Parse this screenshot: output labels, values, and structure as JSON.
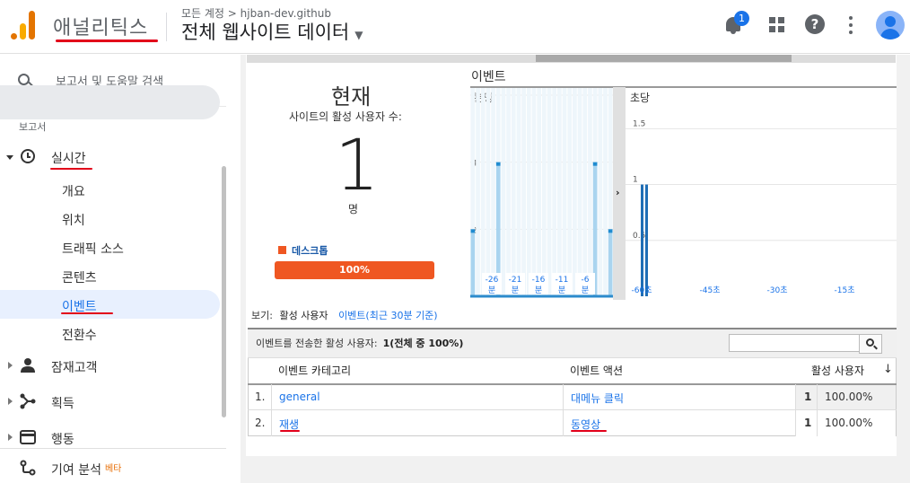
{
  "header": {
    "app_name": "애널리틱스",
    "breadcrumb": "모든 계정 > hjban-dev.github",
    "view_title": "전체 웹사이트 데이터",
    "notification_count": "1",
    "help_symbol": "?"
  },
  "sidebar": {
    "search_label": "보고서 및 도움말 검색",
    "section_label": "보고서",
    "realtime_label": "실시간",
    "realtime_items": [
      "개요",
      "위치",
      "트래픽 소스",
      "콘텐츠",
      "이벤트",
      "전환수"
    ],
    "nav_items": [
      "잠재고객",
      "획득",
      "행동",
      "기여 분석"
    ],
    "beta_label": "베타",
    "accent_color": "#e2001a"
  },
  "summary": {
    "now_title": "현재",
    "subtitle": "사이트의 활성 사용자 수:",
    "active_users": "1",
    "unit": "명",
    "device_label": "데스크톱",
    "device_percent": "100%",
    "device_color": "#ef5722"
  },
  "chart_data": [
    {
      "type": "bar",
      "title": "이벤트",
      "pane_label": "분당",
      "x_tick_labels": [
        "-26\n분",
        "-21\n분",
        "-16\n분",
        "-11\n분",
        "-6\n분"
      ],
      "y_ticks": [
        2,
        4,
        6
      ],
      "ylim": [
        0,
        6
      ],
      "values": [
        2,
        0,
        0,
        0,
        0,
        4,
        0,
        0,
        0,
        0,
        0,
        0,
        0,
        0,
        0,
        0,
        0,
        0,
        0,
        0,
        0,
        0,
        0,
        0,
        4,
        0,
        0,
        2
      ],
      "bar_color": "#7ab8e0"
    },
    {
      "type": "bar",
      "pane_label": "초당",
      "x_tick_labels": [
        "-60초",
        "-45초",
        "-30초",
        "-15초"
      ],
      "y_ticks": [
        0.5,
        1,
        1.5
      ],
      "ylim": [
        0,
        1.8
      ],
      "values": [
        1,
        1
      ],
      "bar_color": "#1f6eb5"
    }
  ],
  "view_bar": {
    "prefix": "보기:",
    "selected": "활성 사용자",
    "link": "이벤트(최근 30분 기준)"
  },
  "table": {
    "summary_label": "이벤트를 전송한 활성 사용자:",
    "summary_value": "1(전체 중 100%)",
    "search_value": "",
    "columns": [
      "이벤트 카테고리",
      "이벤트 액션",
      "활성 사용자"
    ],
    "sort_arrow": "↓",
    "rows": [
      {
        "index": "1.",
        "category": "general",
        "action": "대메뉴 클릭",
        "users": "1",
        "percent": "100.00%"
      },
      {
        "index": "2.",
        "category": "재생",
        "action": "동영상",
        "users": "1",
        "percent": "100.00%"
      }
    ]
  }
}
